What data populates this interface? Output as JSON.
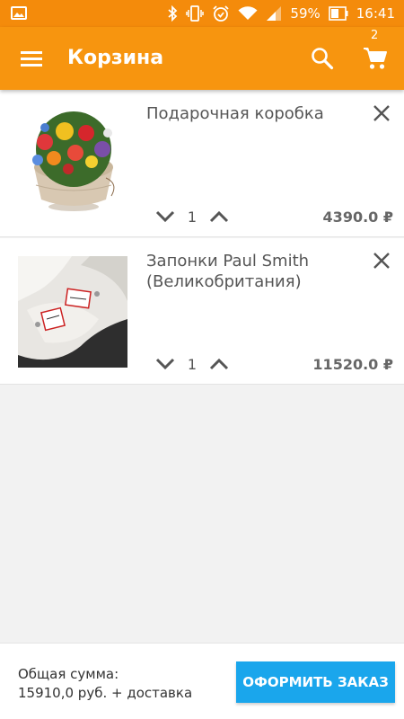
{
  "status_bar": {
    "battery": "59%",
    "time": "16:41",
    "icons": [
      "image-icon",
      "bluetooth-icon",
      "vibrate-icon",
      "alarm-icon",
      "wifi-icon",
      "signal-icon",
      "battery-icon"
    ]
  },
  "app_bar": {
    "title": "Корзина",
    "cart_count": "2",
    "color": "#f7950f",
    "icons": [
      "menu-icon",
      "search-icon",
      "cart-icon"
    ]
  },
  "cart": {
    "items": [
      {
        "name": "Подарочная коробка",
        "quantity": "1",
        "price": "4390.0 ₽",
        "image": "flower-box-photo"
      },
      {
        "name": "Запонки Paul Smith (Великобритания)",
        "quantity": "1",
        "price": "11520.0 ₽",
        "image": "cufflinks-photo"
      }
    ]
  },
  "footer": {
    "total_label": "Общая сумма:",
    "total_value": "15910,0 руб. + доставка",
    "checkout_label": "ОФОРМИТЬ ЗАКАЗ",
    "checkout_color": "#1aa6ec"
  }
}
